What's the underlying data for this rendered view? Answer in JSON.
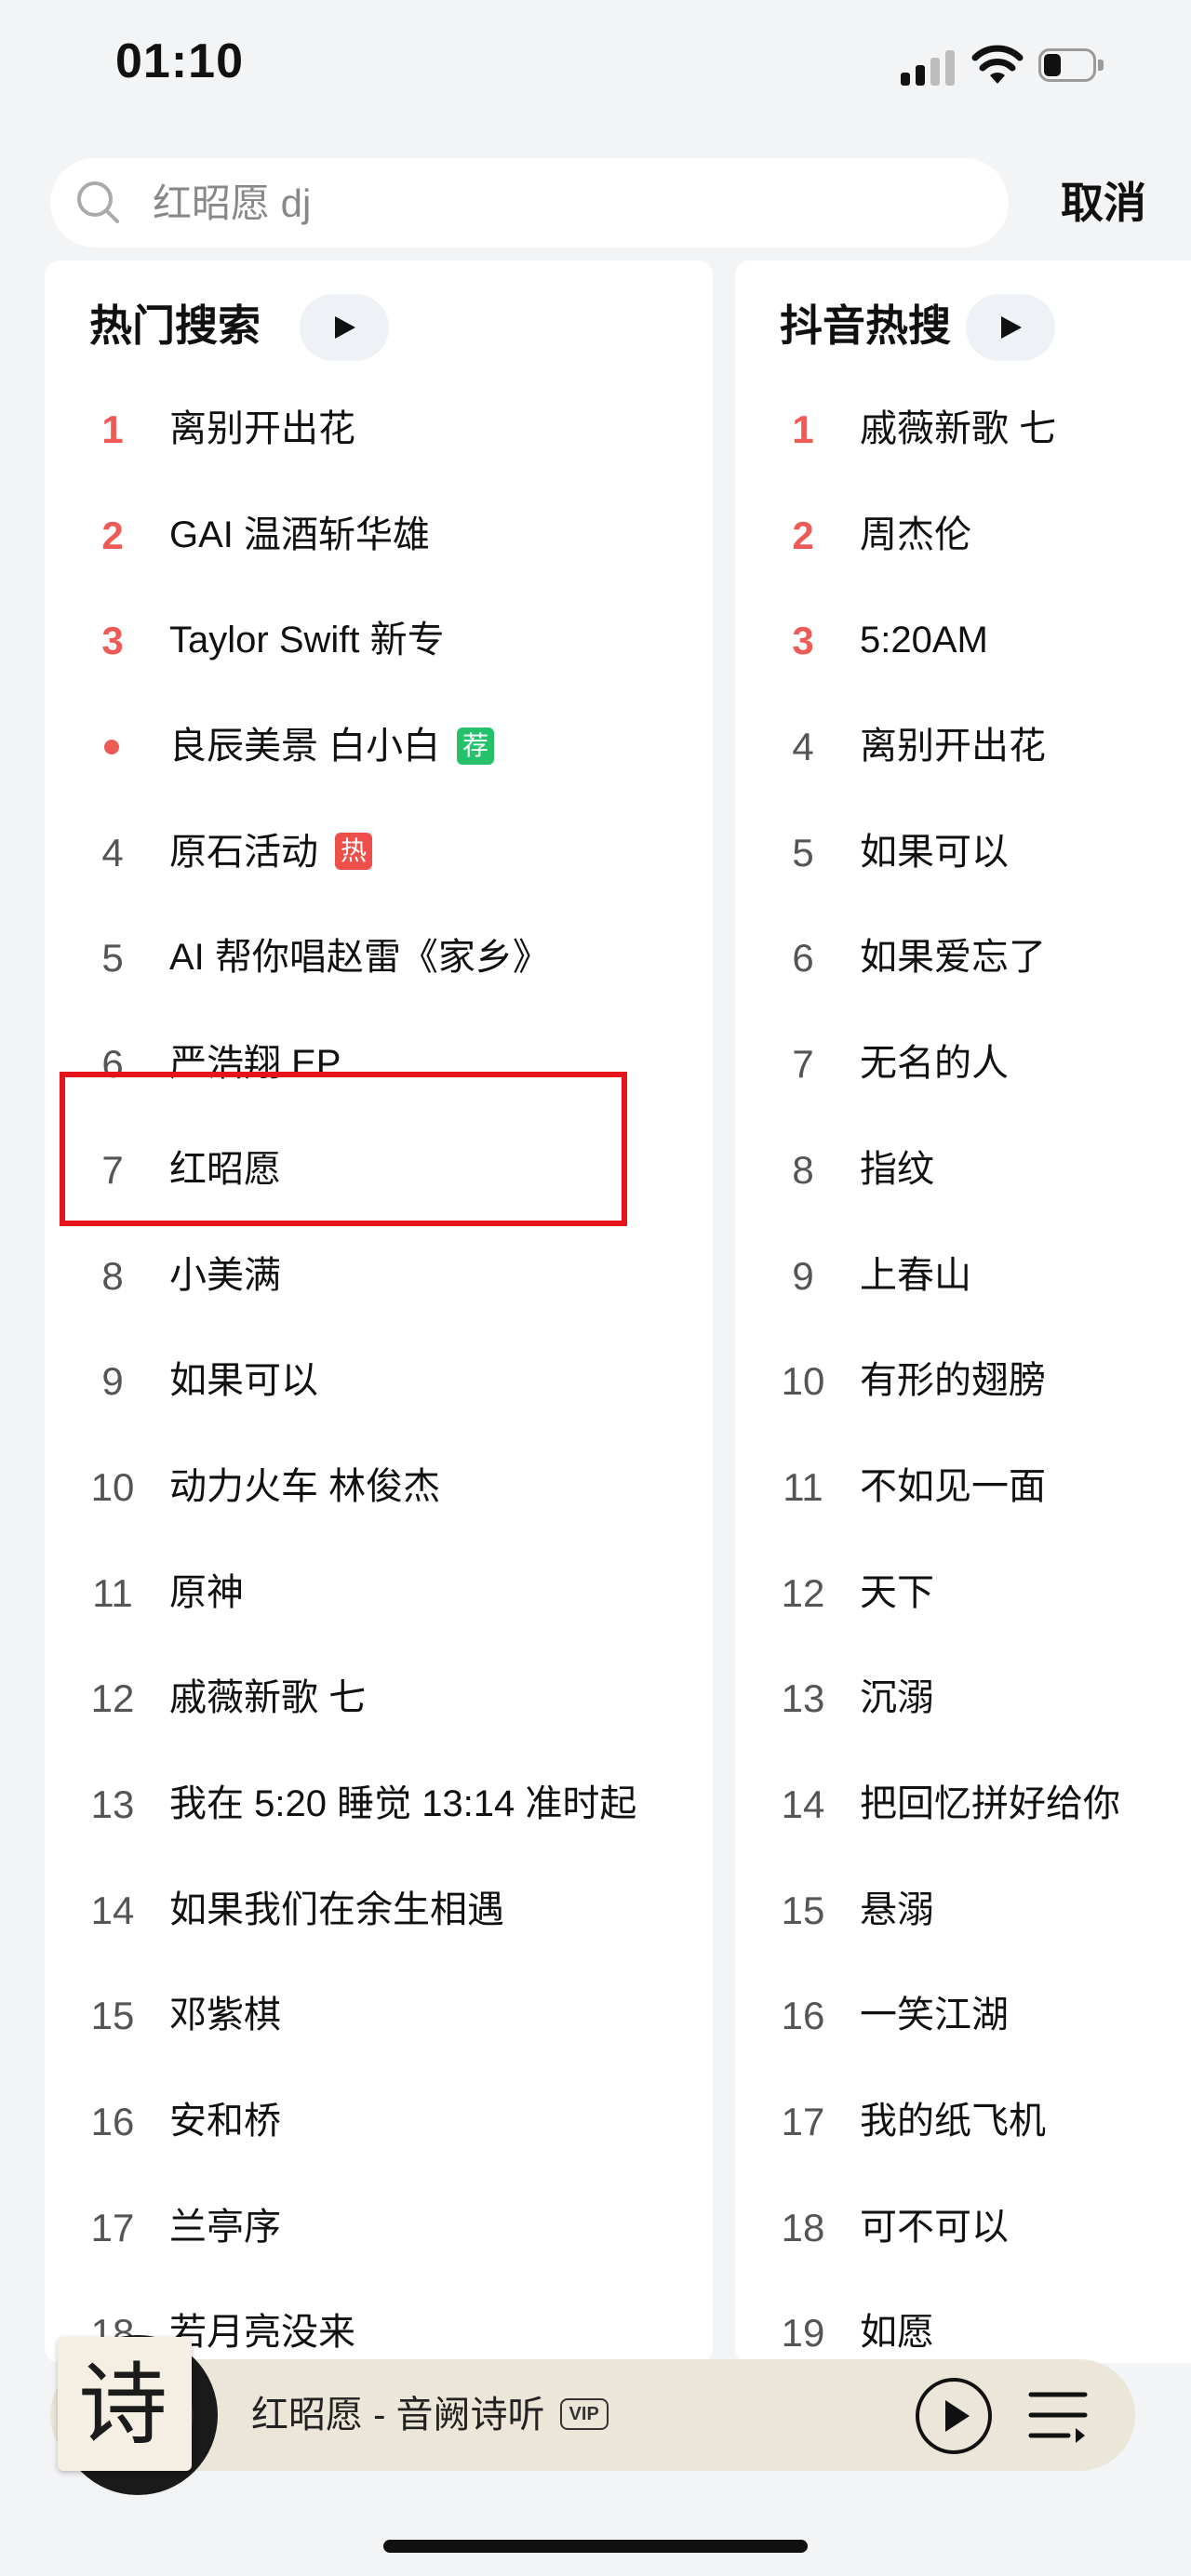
{
  "status_bar": {
    "time": "01:10"
  },
  "search": {
    "query": "红昭愿 dj",
    "cancel_label": "取消"
  },
  "panels": {
    "left": {
      "title": "热门搜索",
      "items": [
        {
          "rank": "1",
          "text": "离别开出花"
        },
        {
          "rank": "2",
          "text": "GAI 温酒斩华雄"
        },
        {
          "rank": "3",
          "text": "Taylor Swift 新专"
        },
        {
          "rank": "",
          "text": "良辰美景 白小白",
          "tag": "荐"
        },
        {
          "rank": "4",
          "text": "原石活动",
          "tag": "热"
        },
        {
          "rank": "5",
          "text": "AI 帮你唱赵雷《家乡》"
        },
        {
          "rank": "6",
          "text": "严浩翔 EP"
        },
        {
          "rank": "7",
          "text": "红昭愿"
        },
        {
          "rank": "8",
          "text": "小美满"
        },
        {
          "rank": "9",
          "text": "如果可以"
        },
        {
          "rank": "10",
          "text": "动力火车 林俊杰"
        },
        {
          "rank": "11",
          "text": "原神"
        },
        {
          "rank": "12",
          "text": "戚薇新歌 七"
        },
        {
          "rank": "13",
          "text": "我在 5:20 睡觉 13:14 准时起"
        },
        {
          "rank": "14",
          "text": "如果我们在余生相遇"
        },
        {
          "rank": "15",
          "text": "邓紫棋"
        },
        {
          "rank": "16",
          "text": "安和桥"
        },
        {
          "rank": "17",
          "text": "兰亭序"
        },
        {
          "rank": "18",
          "text": "若月亮没来"
        }
      ]
    },
    "right": {
      "title": "抖音热搜",
      "items": [
        {
          "rank": "1",
          "text": "戚薇新歌 七"
        },
        {
          "rank": "2",
          "text": "周杰伦"
        },
        {
          "rank": "3",
          "text": "5:20AM"
        },
        {
          "rank": "4",
          "text": "离别开出花"
        },
        {
          "rank": "5",
          "text": "如果可以"
        },
        {
          "rank": "6",
          "text": "如果爱忘了"
        },
        {
          "rank": "7",
          "text": "无名的人"
        },
        {
          "rank": "8",
          "text": "指纹"
        },
        {
          "rank": "9",
          "text": "上春山"
        },
        {
          "rank": "10",
          "text": "有形的翅膀"
        },
        {
          "rank": "11",
          "text": "不如见一面"
        },
        {
          "rank": "12",
          "text": "天下"
        },
        {
          "rank": "13",
          "text": "沉溺"
        },
        {
          "rank": "14",
          "text": "把回忆拼好给你"
        },
        {
          "rank": "15",
          "text": "悬溺"
        },
        {
          "rank": "16",
          "text": "一笑江湖"
        },
        {
          "rank": "17",
          "text": "我的纸飞机"
        },
        {
          "rank": "18",
          "text": "可不可以"
        },
        {
          "rank": "19",
          "text": "如愿"
        }
      ]
    }
  },
  "player": {
    "track": "红昭愿 - 音阙诗听",
    "badge": "VIP",
    "cover_text": "诗"
  },
  "icons": {
    "search": "search-icon",
    "play_all": "play-icon",
    "play": "play-circle-icon",
    "playlist": "playlist-icon"
  },
  "colors": {
    "rank_top": "#ee5a55",
    "tag_recommend": "#26c26b",
    "tag_hot": "#ef4f4a",
    "highlight": "#e4141a"
  }
}
